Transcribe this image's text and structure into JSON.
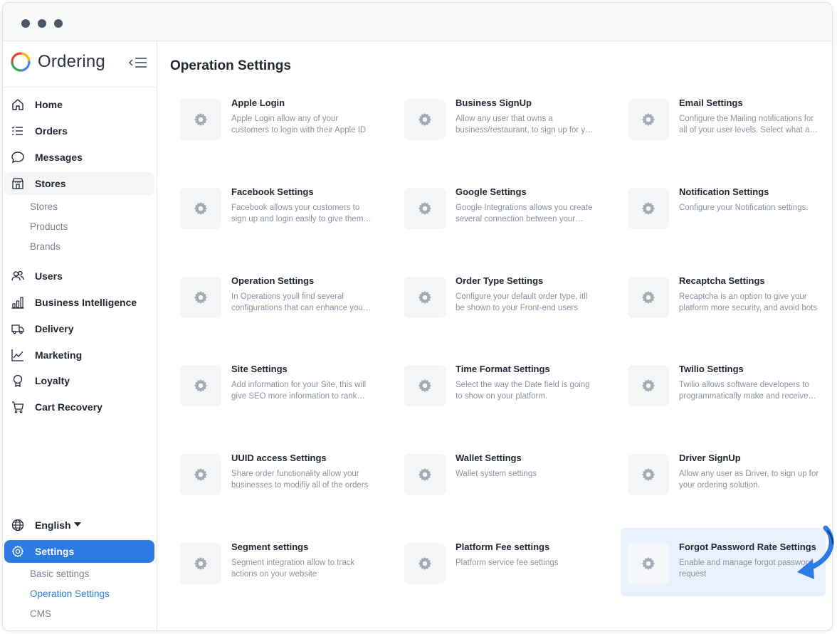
{
  "app": {
    "name": "Ordering"
  },
  "sidebar": {
    "items": [
      {
        "label": "Home",
        "icon": "home-icon"
      },
      {
        "label": "Orders",
        "icon": "list-icon"
      },
      {
        "label": "Messages",
        "icon": "chat-icon"
      },
      {
        "label": "Stores",
        "icon": "store-icon"
      },
      {
        "label": "Users",
        "icon": "users-icon"
      },
      {
        "label": "Business Intelligence",
        "icon": "bar-chart-icon"
      },
      {
        "label": "Delivery",
        "icon": "truck-icon"
      },
      {
        "label": "Marketing",
        "icon": "line-chart-icon"
      },
      {
        "label": "Loyalty",
        "icon": "award-icon"
      },
      {
        "label": "Cart Recovery",
        "icon": "cart-icon"
      }
    ],
    "stores_sub": [
      "Stores",
      "Products",
      "Brands"
    ],
    "language": {
      "label": "English",
      "icon": "globe-icon"
    },
    "settings": {
      "label": "Settings",
      "icon": "gear-icon"
    },
    "settings_sub": [
      "Basic settings",
      "Operation Settings",
      "CMS"
    ]
  },
  "main": {
    "title": "Operation Settings",
    "cards": [
      {
        "title": "Apple Login",
        "desc": "Apple Login allow any of your customers to login with their Apple ID"
      },
      {
        "title": "Business SignUp",
        "desc": "Allow any user that owns a business/restaurant, to sign up for your ordering solution"
      },
      {
        "title": "Email Settings",
        "desc": "Configure the Mailing notifications for all of your user levels. Select what and when to send"
      },
      {
        "title": "Facebook Settings",
        "desc": "Facebook allows your customers to sign up and login easily to give them the best experience"
      },
      {
        "title": "Google Settings",
        "desc": "Google Integrations allows you create several connection between your platform and Google"
      },
      {
        "title": "Notification Settings",
        "desc": "Configure your Notification settings."
      },
      {
        "title": "Operation Settings",
        "desc": "In Operations youll find several configurations that can enhance your platform"
      },
      {
        "title": "Order Type Settings",
        "desc": "Configure your default order type, itll be shown to your Front-end users"
      },
      {
        "title": "Recaptcha Settings",
        "desc": "Recaptcha is an option to give your platform more security, and avoid bots"
      },
      {
        "title": "Site Settings",
        "desc": "Add information for your Site, this will give SEO more information to rank your site"
      },
      {
        "title": "Time Format Settings",
        "desc": "Select the way the Date field is going to show on your platform."
      },
      {
        "title": "Twilio Settings",
        "desc": "Twilio allows software developers to programmatically make and receive phone calls"
      },
      {
        "title": "UUID access Settings",
        "desc": "Share order functionality allow your businesses to modifiy all of the orders"
      },
      {
        "title": "Wallet Settings",
        "desc": "Wallet system settings"
      },
      {
        "title": "Driver SignUp",
        "desc": "Allow any user as Driver, to sign up for your ordering solution."
      },
      {
        "title": "Segment settings",
        "desc": "Segment integration allow to track actions on your website"
      },
      {
        "title": "Platform Fee settings",
        "desc": "Platform service fee settings"
      },
      {
        "title": "Forgot Password Rate Settings",
        "desc": "Enable and manage forgot password request"
      }
    ]
  },
  "colors": {
    "accent": "#2c7be5",
    "highlight": "#e8f1fd",
    "arrow": "#2c7be5"
  }
}
